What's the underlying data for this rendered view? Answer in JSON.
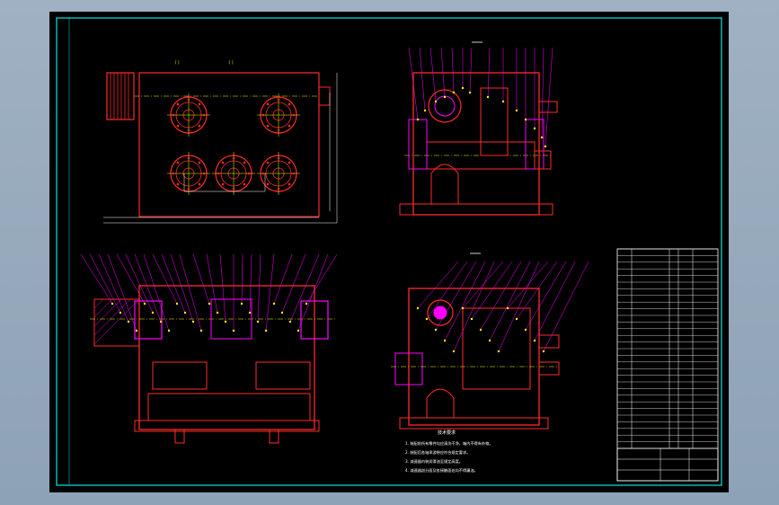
{
  "drawing": {
    "background": "#000000",
    "colors": {
      "frame": "#00e5e5",
      "outline": "#ff2a2a",
      "leader": "#ff00ff",
      "center": "#ffff00",
      "dims": "#ffffff",
      "hatch": "#ff00ff"
    },
    "tech_notes": {
      "title": "技术要求",
      "items": [
        "1. 装配前所有零件均应清洗干净，箱内不得有杂物。",
        "2. 装配后各轴承游隙应符合规定要求。",
        "3. 减速器内装润滑油至规定高度。",
        "4. 减速器剖分面及各接触面处均不得漏油。"
      ]
    }
  }
}
